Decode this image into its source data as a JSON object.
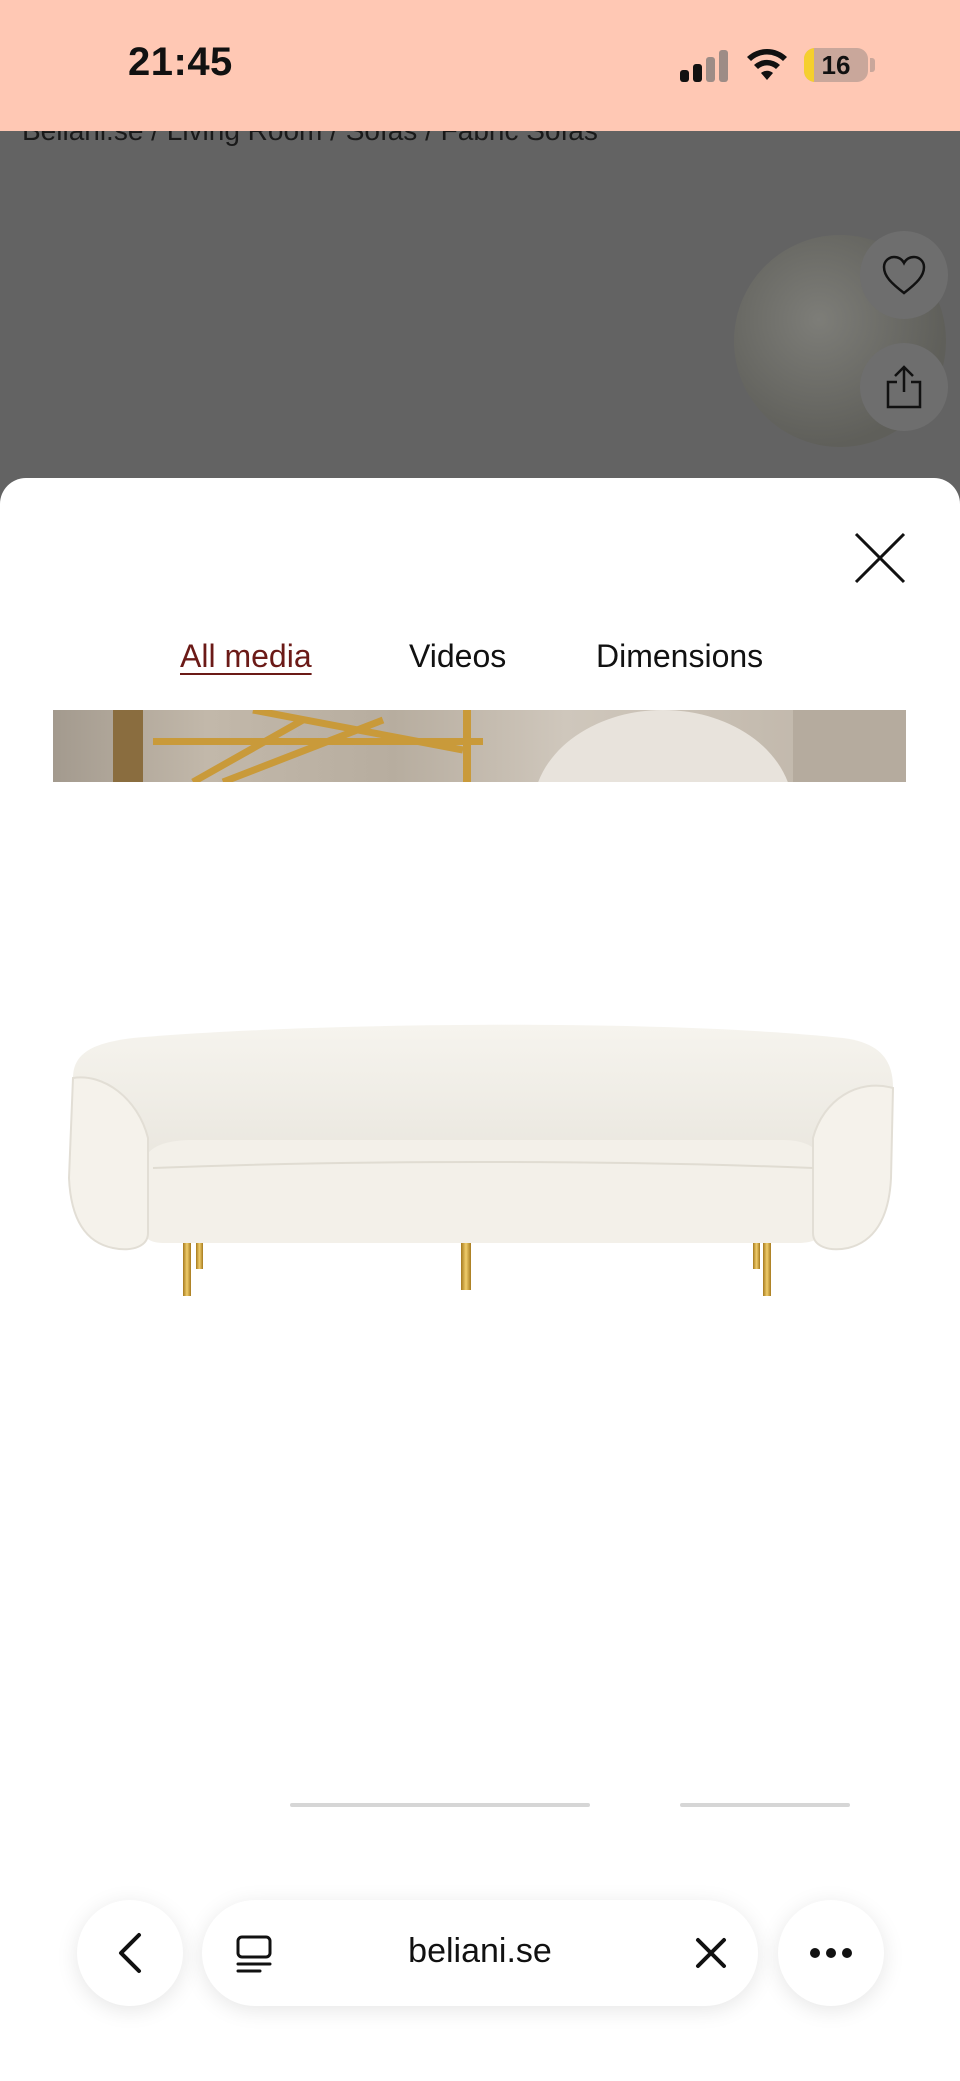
{
  "status_bar": {
    "time": "21:45",
    "battery_level": "16"
  },
  "background_page": {
    "breadcrumb": "Beliani.se / Living Room / Sofas / Fabric Sofas"
  },
  "modal": {
    "tabs": [
      {
        "label": "All media",
        "active": true
      },
      {
        "label": "Videos",
        "active": false
      },
      {
        "label": "Dimensions",
        "active": false
      }
    ]
  },
  "browser": {
    "url": "beliani.se"
  },
  "colors": {
    "status_bar_bg": "#ffc8b4",
    "active_tab": "#6b1a17",
    "overlay": "#636363"
  }
}
